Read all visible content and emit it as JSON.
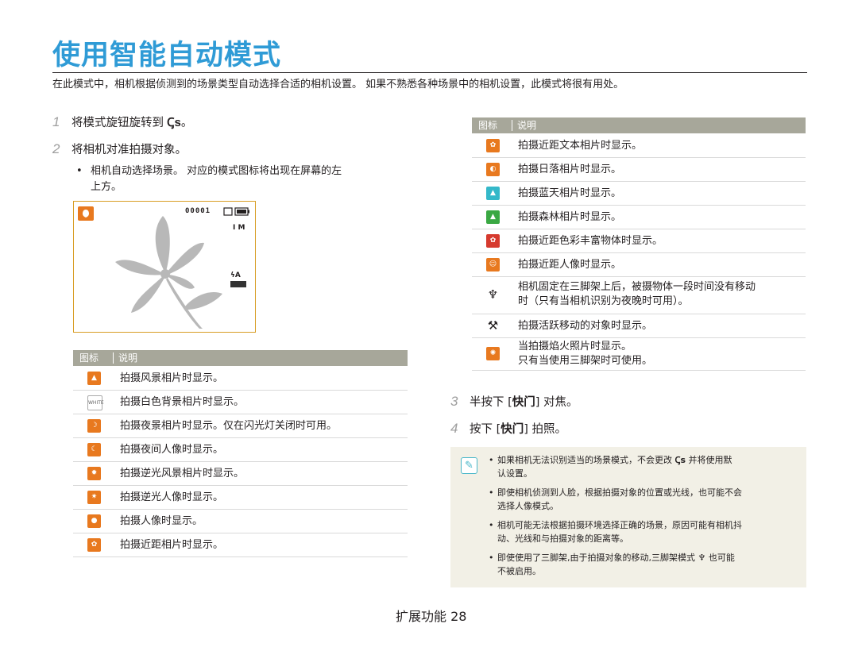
{
  "page": {
    "title": "使用智能自动模式",
    "intro": "在此模式中，相机根据侦测到的场景类型自动选择合适的相机设置。 如果不熟悉各种场景中的相机设置，此模式将很有用处。",
    "footer": "扩展功能  28"
  },
  "steps": {
    "s1_num": "1",
    "s1_text": "将模式旋钮旋转到",
    "s1_glyph": "Ꞔs",
    "s1_end": "。",
    "s2_num": "2",
    "s2_text": "将相机对准拍摄对象。",
    "s2_bullet_1": "相机自动选择场景。 对应的模式图标将出现在屏幕的左",
    "s2_bullet_2": "上方。",
    "s3_num": "3",
    "s3_pre": "半按下 [",
    "s3_key": "快门",
    "s3_post": "] 对焦。",
    "s4_num": "4",
    "s4_pre": "按下 [",
    "s4_key": "快门",
    "s4_post": "] 拍照。"
  },
  "camera_screen": {
    "counter": "00001",
    "side_top": "I M",
    "side_flash": "ϟA"
  },
  "table_headers": {
    "icon": "图标",
    "description": "说明"
  },
  "left_table": [
    {
      "icon": "landscape-icon",
      "text": "拍摄风景相片时显示。"
    },
    {
      "icon": "white-background-icon",
      "text": "拍摄白色背景相片时显示。"
    },
    {
      "icon": "night-icon",
      "text": "拍摄夜景相片时显示。仅在闪光灯关闭时可用。"
    },
    {
      "icon": "night-portrait-icon",
      "text": "拍摄夜间人像时显示。"
    },
    {
      "icon": "backlit-landscape-icon",
      "text": "拍摄逆光风景相片时显示。"
    },
    {
      "icon": "backlit-portrait-icon",
      "text": "拍摄逆光人像时显示。"
    },
    {
      "icon": "portrait-icon",
      "text": "拍摄人像时显示。"
    },
    {
      "icon": "macro-icon",
      "text": "拍摄近距相片时显示。"
    }
  ],
  "right_table": [
    {
      "icon": "macro-text-icon",
      "text": "拍摄近距文本相片时显示。"
    },
    {
      "icon": "sunset-icon",
      "text": "拍摄日落相片时显示。"
    },
    {
      "icon": "blue-sky-icon",
      "text": "拍摄蓝天相片时显示。"
    },
    {
      "icon": "forest-icon",
      "text": "拍摄森林相片时显示。"
    },
    {
      "icon": "macro-color-icon",
      "text": "拍摄近距色彩丰富物体时显示。"
    },
    {
      "icon": "macro-portrait-icon",
      "text": "拍摄近距人像时显示。"
    },
    {
      "icon": "tripod-icon",
      "text_1": "相机固定在三脚架上后，被摄物体一段时间没有移动",
      "text_2": "时（只有当相机识别为夜晚时可用）。"
    },
    {
      "icon": "action-icon",
      "text": "拍摄活跃移动的对象时显示。"
    },
    {
      "icon": "fireworks-icon",
      "text_1": "当拍摄焰火照片时显示。",
      "text_2": "只有当使用三脚架时可使用。"
    }
  ],
  "notes": [
    {
      "line_1": "如果相机无法识别适当的场景模式，不会更改",
      "glyph": "Ꞔs",
      "line_1b": "并将使用默",
      "line_2": "认设置。"
    },
    {
      "line_1": "即使相机侦测到人脸，根据拍摄对象的位置或光线，也可能不会",
      "line_2": "选择人像模式。"
    },
    {
      "line_1": "相机可能无法根据拍摄环境选择正确的场景，原因可能有相机抖",
      "line_2": "动、光线和与拍摄对象的距离等。"
    },
    {
      "line_1": "即使使用了三脚架,由于拍摄对象的移动,三脚架模式",
      "line_1b": "也可能",
      "line_2": "不被启用。"
    }
  ],
  "colors": {
    "title": "#2f9bd6",
    "icon_orange": "#e8791f",
    "table_header": "#a7a79a",
    "note_bg": "#f2f0e6"
  }
}
